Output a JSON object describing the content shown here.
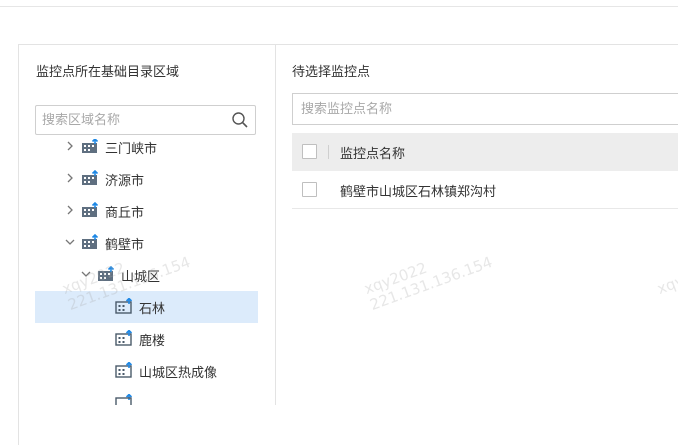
{
  "left_panel": {
    "title": "监控点所在基础目录区域",
    "search_placeholder": "搜索区域名称",
    "tree": [
      {
        "label": "三门峡市",
        "expanded": false,
        "selected": false,
        "icon": "region-city-icon"
      },
      {
        "label": "济源市",
        "expanded": false,
        "selected": false,
        "icon": "region-city-icon"
      },
      {
        "label": "商丘市",
        "expanded": false,
        "selected": false,
        "icon": "region-city-icon"
      },
      {
        "label": "鹤壁市",
        "expanded": true,
        "selected": false,
        "icon": "region-city-icon"
      },
      {
        "label": "山城区",
        "expanded": true,
        "selected": false,
        "icon": "region-city-icon"
      },
      {
        "label": "石林",
        "selected": true,
        "icon": "region-leaf-icon"
      },
      {
        "label": "鹿楼",
        "selected": false,
        "icon": "region-leaf-icon"
      },
      {
        "label": "山城区热成像",
        "selected": false,
        "icon": "region-leaf-icon"
      }
    ]
  },
  "right_panel": {
    "title": "待选择监控点",
    "search_placeholder": "搜索监控点名称",
    "table": {
      "header": "监控点名称",
      "rows": [
        {
          "name": "鹤壁市山城区石林镇郑沟村",
          "checked": false
        }
      ]
    }
  },
  "watermark": {
    "user": "xqy2022",
    "ip": "221.131.136.154"
  },
  "colors": {
    "selected_row": "#dcebfb",
    "table_header": "#ededed",
    "border": "#e3e3e3",
    "icon_blue": "#1e88e5"
  }
}
